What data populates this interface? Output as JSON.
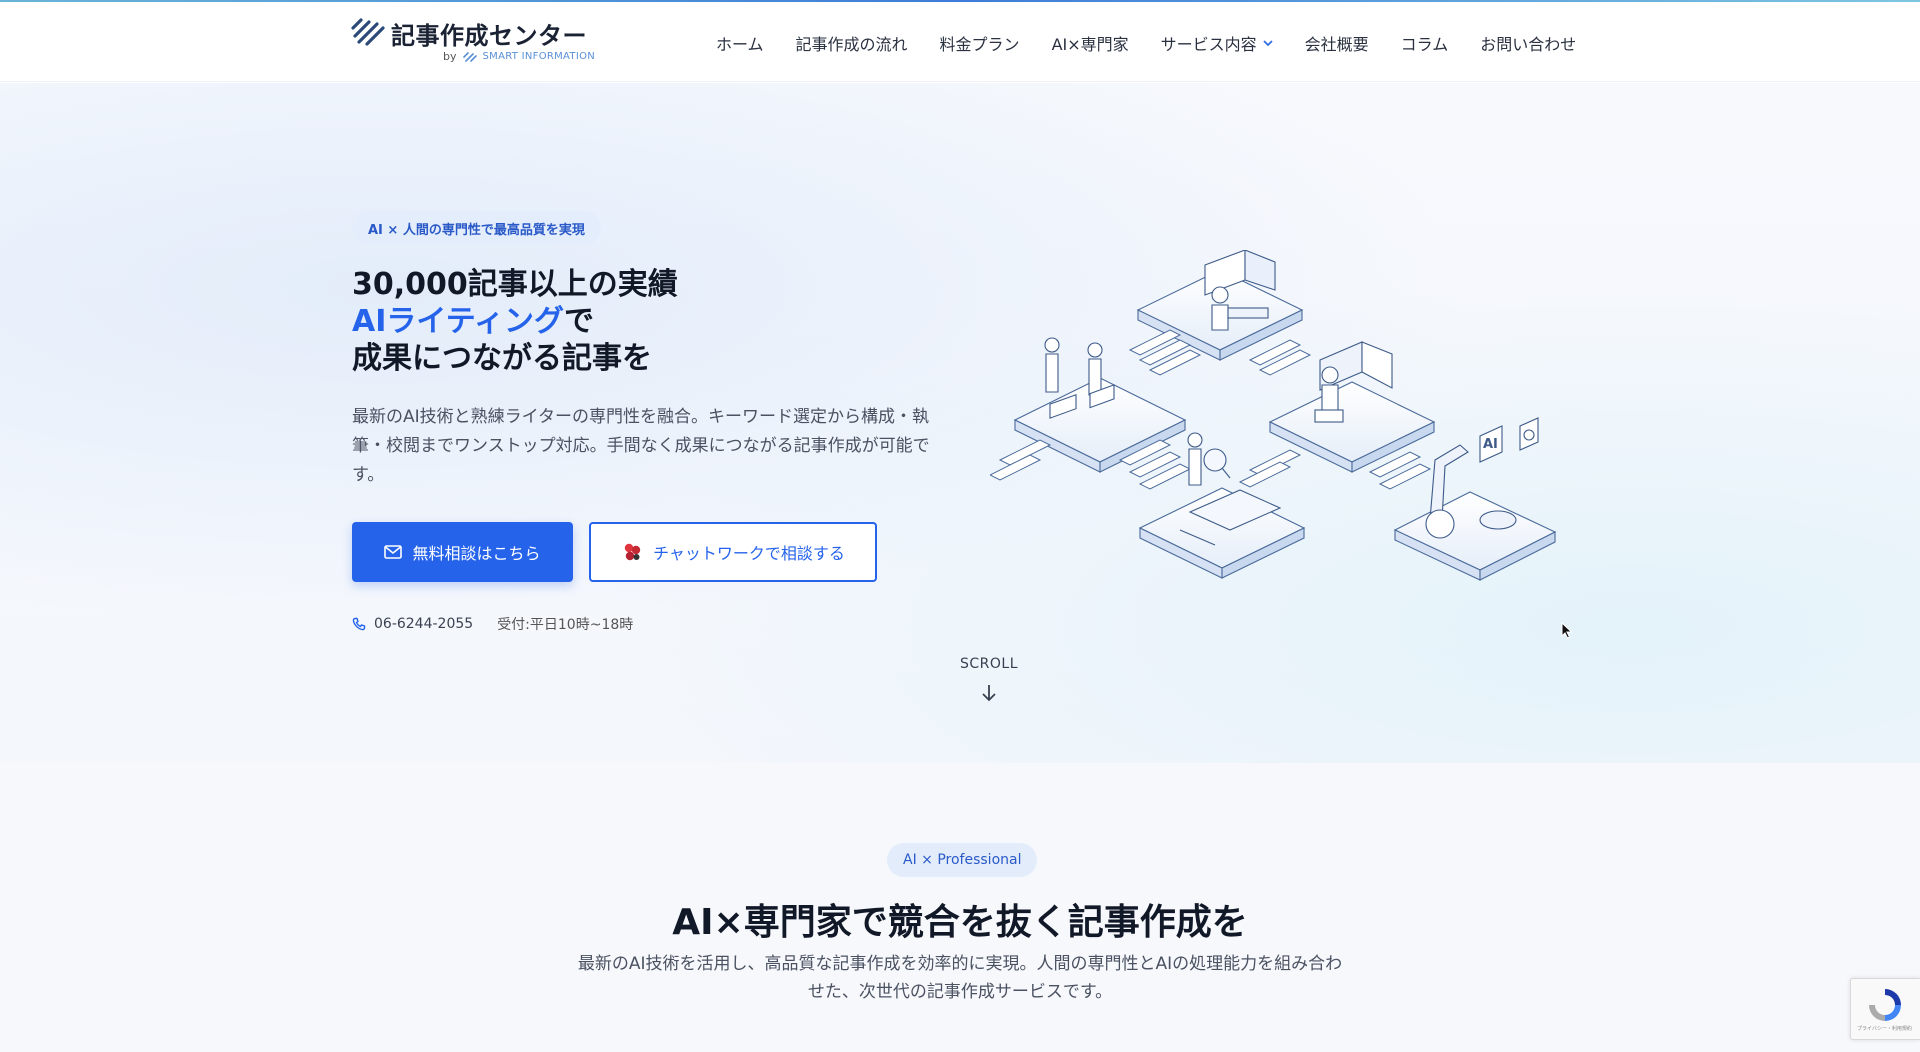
{
  "brand": {
    "name": "記事作成センター",
    "by": "by",
    "parent": "SMART INFORMATION"
  },
  "nav": {
    "items": [
      {
        "label": "ホーム"
      },
      {
        "label": "記事作成の流れ"
      },
      {
        "label": "料金プラン"
      },
      {
        "label": "AI×専門家"
      },
      {
        "label": "サービス内容",
        "has_dropdown": true
      },
      {
        "label": "会社概要"
      },
      {
        "label": "コラム"
      },
      {
        "label": "お問い合わせ"
      }
    ]
  },
  "hero": {
    "badge": "AI × 人間の専門性で最高品質を実現",
    "title_line1": "30,000記事以上の実績",
    "title_line2_accent": "AIライティング",
    "title_line2_rest": "で",
    "title_line3": "成果につながる記事を",
    "lead": "最新のAI技術と熟練ライターの専門性を融合。キーワード選定から構成・執筆・校閲までワンストップ対応。手間なく成果につながる記事作成が可能です。",
    "cta_primary": "無料相談はこちら",
    "cta_secondary": "チャットワークで相談する",
    "phone": "06-6244-2055",
    "hours": "受付:平日10時~18時",
    "scroll": "SCROLL",
    "illustration_label": "AI"
  },
  "section2": {
    "pill": "AI × Professional",
    "title": "AI×専門家で競合を抜く記事作成を",
    "subtitle": "最新のAI技術を活用し、高品質な記事作成を効率的に実現。人間の専門性とAIの処理能力を組み合わせた、次世代の記事作成サービスです。"
  },
  "recaptcha": {
    "label": "プライバシー・利用規約"
  },
  "colors": {
    "accent": "#2563eb",
    "badge_bg": "#e4edfb",
    "heading": "#111827",
    "body_text": "#4a5262"
  },
  "icons": {
    "logo": "stripes-logo-icon",
    "dropdown": "chevron-down-icon",
    "mail": "mail-icon",
    "chatwork": "chatwork-icon",
    "phone": "phone-icon",
    "scroll": "arrow-down-icon",
    "cursor": "mouse-pointer-icon"
  }
}
